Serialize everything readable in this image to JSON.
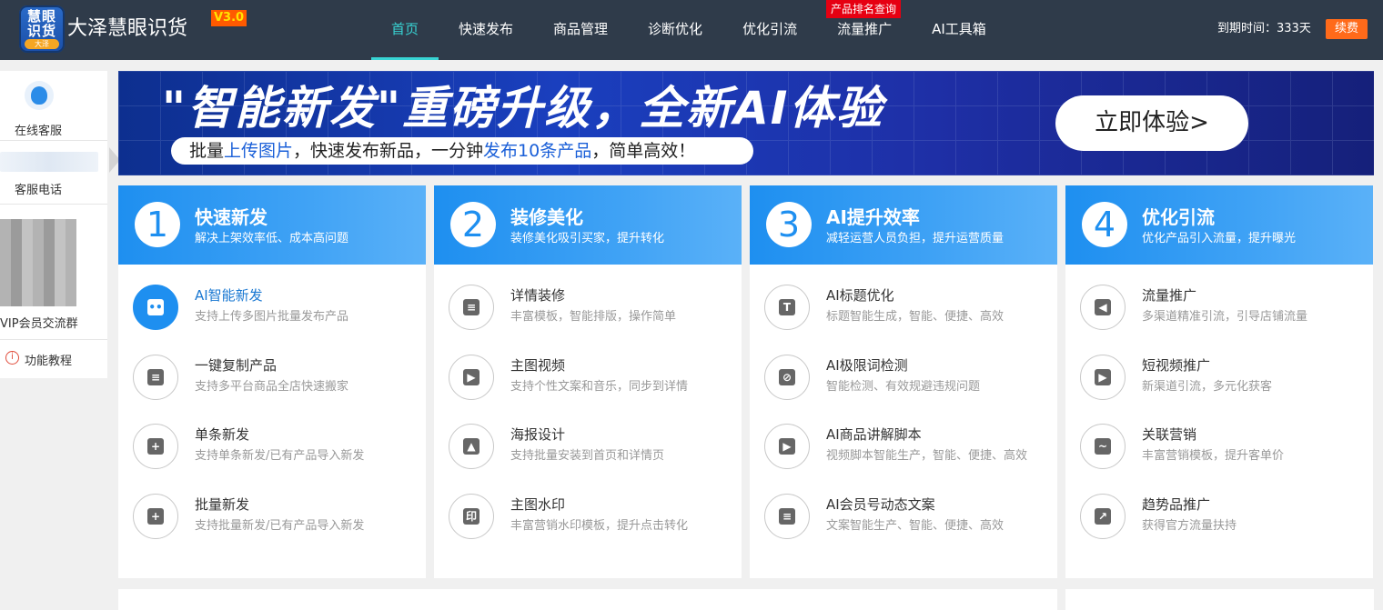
{
  "header": {
    "logo_text": "慧眼识货",
    "logo_badge": "大泽",
    "brand": "大泽慧眼识货",
    "version": "V3.0",
    "nav": [
      {
        "label": "首页",
        "active": true
      },
      {
        "label": "快速发布"
      },
      {
        "label": "商品管理"
      },
      {
        "label": "诊断优化"
      },
      {
        "label": "优化引流"
      },
      {
        "label": "流量推广"
      },
      {
        "label": "AI工具箱"
      }
    ],
    "rank_badge": "产品排名查询",
    "expire_label": "到期时间：333天",
    "renew_label": "续费"
  },
  "sidebar": {
    "customer_service": "在线客服",
    "phone_label": "客服电话",
    "vip_group": "VIP会员交流群",
    "tutorial": "功能教程",
    "info_icon_glyph": "i"
  },
  "banner": {
    "title": "\"智能新发\"重磅升级，全新AI体验",
    "sub_1": "批量",
    "sub_hl_1": "上传图片",
    "sub_2": "，快速发布新品，一分钟",
    "sub_hl_2": "发布10条产品",
    "sub_3": "，简单高效！",
    "cta": "立即体验>"
  },
  "cards": [
    {
      "num": "1",
      "title": "快速新发",
      "desc": "解决上架效率低、成本高问题",
      "items": [
        {
          "icon": "robot-icon",
          "glyph": "••",
          "title": "AI智能新发",
          "desc": "支持上传多图片批量发布产品",
          "primary": true
        },
        {
          "icon": "copy-icon",
          "glyph": "≡",
          "title": "一键复制产品",
          "desc": "支持多平台商品全店快速搬家"
        },
        {
          "icon": "plus-square-icon",
          "glyph": "+",
          "title": "单条新发",
          "desc": "支持单条新发/已有产品导入新发"
        },
        {
          "icon": "batch-add-icon",
          "glyph": "+",
          "title": "批量新发",
          "desc": "支持批量新发/已有产品导入新发"
        }
      ]
    },
    {
      "num": "2",
      "title": "装修美化",
      "desc": "装修美化吸引买家，提升转化",
      "items": [
        {
          "icon": "document-icon",
          "glyph": "≡",
          "title": "详情装修",
          "desc": "丰富模板，智能排版，操作简单"
        },
        {
          "icon": "video-icon",
          "glyph": "▶",
          "title": "主图视频",
          "desc": "支持个性文案和音乐，同步到详情"
        },
        {
          "icon": "image-icon",
          "glyph": "▲",
          "title": "海报设计",
          "desc": "支持批量安装到首页和详情页"
        },
        {
          "icon": "stamp-icon",
          "glyph": "印",
          "title": "主图水印",
          "desc": "丰富营销水印模板，提升点击转化"
        }
      ]
    },
    {
      "num": "3",
      "title": "AI提升效率",
      "desc": "减轻运营人员负担，提升运营质量",
      "items": [
        {
          "icon": "text-icon",
          "glyph": "T",
          "title": "AI标题优化",
          "desc": "标题智能生成，智能、便捷、高效"
        },
        {
          "icon": "forbidden-icon",
          "glyph": "⊘",
          "title": "AI极限词检测",
          "desc": "智能检测、有效规避违规问题"
        },
        {
          "icon": "script-icon",
          "glyph": "▶",
          "title": "AI商品讲解脚本",
          "desc": "视频脚本智能生产，智能、便捷、高效"
        },
        {
          "icon": "note-icon",
          "glyph": "≡",
          "title": "AI会员号动态文案",
          "desc": "文案智能生产、智能、便捷、高效"
        }
      ]
    },
    {
      "num": "4",
      "title": "优化引流",
      "desc": "优化产品引入流量，提升曝光",
      "items": [
        {
          "icon": "megaphone-icon",
          "glyph": "◀",
          "title": "流量推广",
          "desc": "多渠道精准引流，引导店铺流量"
        },
        {
          "icon": "play-icon",
          "glyph": "▶",
          "title": "短视频推广",
          "desc": "新渠道引流，多元化获客"
        },
        {
          "icon": "chart-icon",
          "glyph": "~",
          "title": "关联营销",
          "desc": "丰富营销模板，提升客单价"
        },
        {
          "icon": "trend-icon",
          "glyph": "↗",
          "title": "趋势品推广",
          "desc": "获得官方流量扶持"
        }
      ]
    }
  ]
}
